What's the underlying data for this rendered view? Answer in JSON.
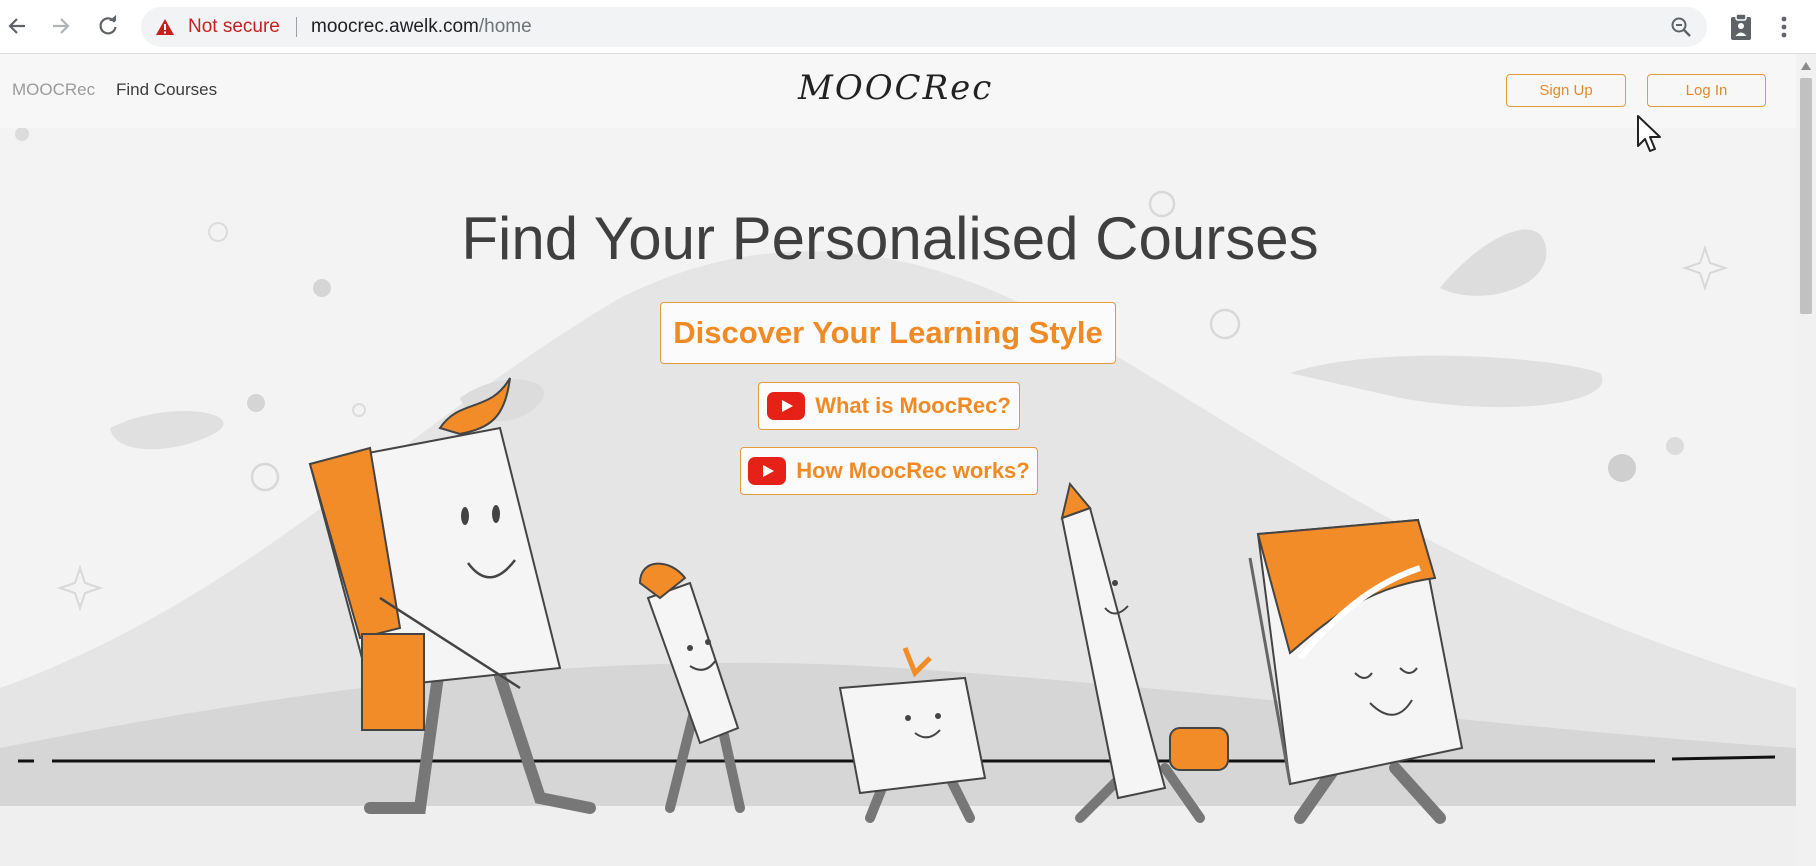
{
  "browser": {
    "security_label": "Not secure",
    "url_host": "moocrec.awelk.com",
    "url_path": "/home",
    "icons": [
      "back-arrow-icon",
      "forward-arrow-icon",
      "reload-icon",
      "warning-icon",
      "zoom-out-icon",
      "clipboard-extension-icon",
      "menu-dots-icon"
    ]
  },
  "header": {
    "brand": "MOOCRec",
    "nav_link": "Find Courses",
    "logo": "MOOCRec",
    "signup_label": "Sign Up",
    "login_label": "Log In"
  },
  "hero": {
    "title": "Find Your Personalised Courses",
    "discover_label": "Discover Your Learning Style",
    "video1_label": "What is MoocRec?",
    "video2_label": "How MoocRec works?"
  },
  "colors": {
    "accent": "#f08a24",
    "button_border": "#e59a3c",
    "youtube_red": "#e62117",
    "warning_red": "#c5221f"
  }
}
